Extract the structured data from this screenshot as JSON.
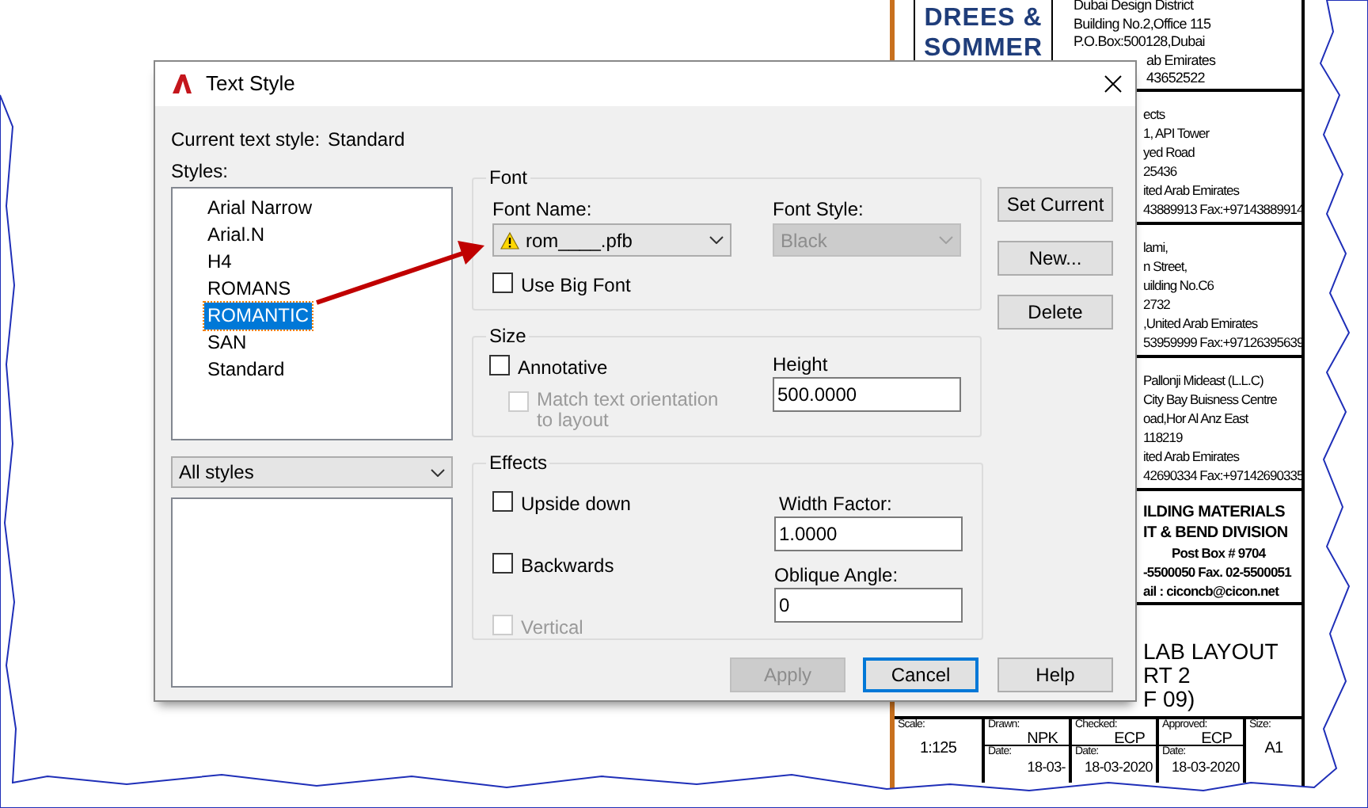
{
  "window": {
    "title": "Text Style"
  },
  "current_style": {
    "label": "Current text style:",
    "value": "Standard"
  },
  "styles": {
    "label": "Styles:",
    "items": [
      {
        "label": "Arial Narrow",
        "selected": false
      },
      {
        "label": "Arial.N",
        "selected": false
      },
      {
        "label": "H4",
        "selected": false
      },
      {
        "label": "ROMANS",
        "selected": false
      },
      {
        "label": "ROMANTIC",
        "selected": true
      },
      {
        "label": "SAN",
        "selected": false
      },
      {
        "label": "Standard",
        "selected": false
      }
    ]
  },
  "filter": {
    "value": "All styles"
  },
  "font": {
    "legend": "Font",
    "font_name": {
      "label": "Font Name:",
      "value": "rom____.pfb"
    },
    "font_style": {
      "label": "Font Style:",
      "value": "Black",
      "disabled": true
    },
    "use_big_font": {
      "label": "Use Big Font",
      "checked": false
    }
  },
  "size": {
    "legend": "Size",
    "annotative": {
      "label": "Annotative",
      "checked": false
    },
    "match_orientation": {
      "label": "Match text orientation to layout",
      "checked": false,
      "disabled": true
    },
    "height": {
      "label": "Height",
      "value": "500.0000"
    }
  },
  "effects": {
    "legend": "Effects",
    "checkboxes": [
      {
        "label": "Upside down",
        "checked": false,
        "disabled": false
      },
      {
        "label": "Backwards",
        "checked": false,
        "disabled": false
      },
      {
        "label": "Vertical",
        "checked": false,
        "disabled": true
      }
    ],
    "width_factor": {
      "label": "Width Factor:",
      "value": "1.0000"
    },
    "oblique_angle": {
      "label": "Oblique Angle:",
      "value": "0"
    }
  },
  "side_buttons": [
    {
      "label": "Set Current"
    },
    {
      "label": "New..."
    },
    {
      "label": "Delete"
    }
  ],
  "buttons": [
    {
      "label": "Apply",
      "disabled": true,
      "focused": false
    },
    {
      "label": "Cancel",
      "disabled": false,
      "focused": true
    },
    {
      "label": "Help",
      "disabled": false,
      "focused": false
    }
  ],
  "title_block": {
    "logo": {
      "lines": [
        "DREES &",
        "SOMMER"
      ]
    },
    "first_address": {
      "lines": [
        "Dubai Design District",
        "Building No.2,Office 115",
        "P.O.Box:500128,Dubai"
      ],
      "cut_lines": [
        "ab Emirates",
        "43652522"
      ]
    },
    "address_rows": [
      {
        "lines": [
          "ects",
          "1, API Tower",
          "yed Road",
          "25436",
          "ited Arab Emirates",
          "43889913 Fax:+97143889914"
        ]
      },
      {
        "lines": [
          "lami,",
          "n Street,",
          "uilding No.C6",
          "2732",
          ",United Arab Emirates",
          "53959999 Fax:+97126395639"
        ]
      },
      {
        "lines": [
          "Pallonji Mideast (L.L.C)",
          "City Bay Buisness Centre",
          "oad,Hor Al Anz East",
          "118219",
          "ited Arab Emirates",
          "42690334 Fax:+97142690335"
        ]
      }
    ],
    "contractor": {
      "lines": [
        "ILDING MATERIALS",
        "IT & BEND DIVISION",
        "Post Box # 9704",
        "-5500050 Fax. 02-5500051",
        "ail : ciconcb@cicon.net"
      ]
    },
    "drawing_title": {
      "lines": [
        "LAB LAYOUT",
        "RT 2",
        "F 09)"
      ]
    },
    "info_cells": [
      {
        "label": "Scale:",
        "value": "1:125"
      },
      {
        "label": "Drawn:",
        "value": "NPK",
        "date_label": "Date:",
        "date": "18-03-"
      },
      {
        "label": "Checked:",
        "value": "ECP",
        "date_label": "Date:",
        "date": "18-03-2020"
      },
      {
        "label": "Approved:",
        "value": "ECP",
        "date_label": "Date:",
        "date": "18-03-2020"
      },
      {
        "label": "Size:",
        "value": "A1"
      }
    ]
  }
}
